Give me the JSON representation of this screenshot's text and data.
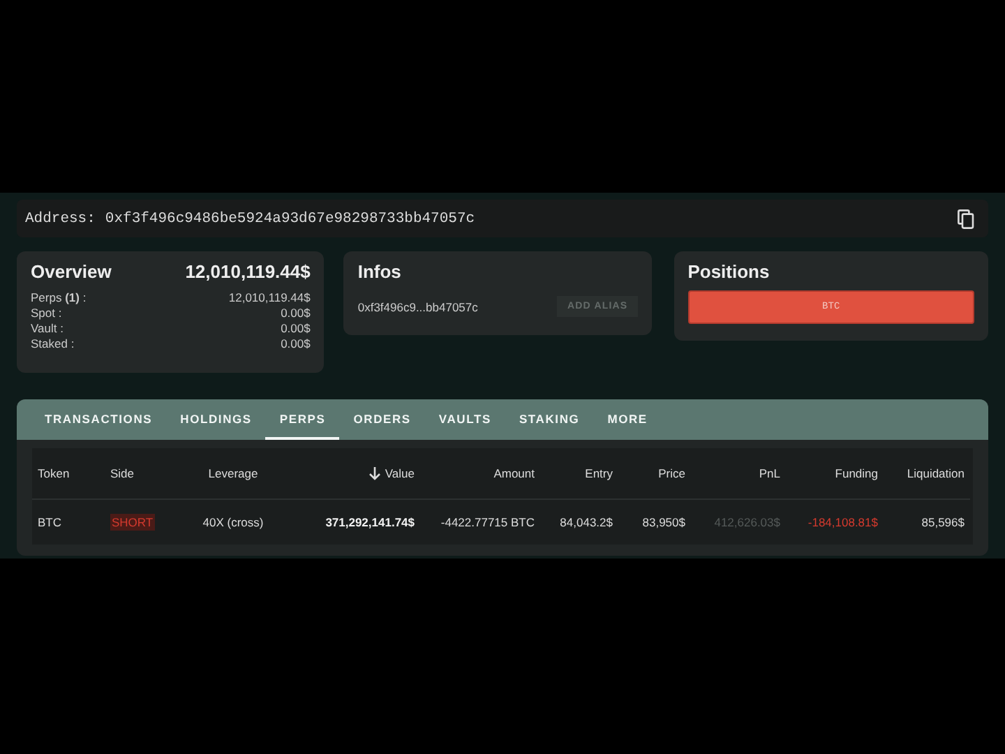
{
  "address": {
    "label": "Address:",
    "value": "0xf3f496c9486be5924a93d67e98298733bb47057c"
  },
  "overview": {
    "title": "Overview",
    "total": "12,010,119.44$",
    "rows": [
      {
        "label": "Perps **(1)** :",
        "value": "12,010,119.44$"
      },
      {
        "label": "Spot :",
        "value": "0.00$"
      },
      {
        "label": "Vault :",
        "value": "0.00$"
      },
      {
        "label": "Staked :",
        "value": "0.00$"
      }
    ]
  },
  "infos": {
    "title": "Infos",
    "short_address": "0xf3f496c9...bb47057c",
    "alias_button": "ADD ALIAS"
  },
  "positions": {
    "title": "Positions",
    "items": [
      {
        "label": "BTC",
        "color": "#e0513f"
      }
    ]
  },
  "tabs": [
    {
      "label": "TRANSACTIONS",
      "selected": false
    },
    {
      "label": "HOLDINGS",
      "selected": false
    },
    {
      "label": "PERPS",
      "selected": true
    },
    {
      "label": "ORDERS",
      "selected": false
    },
    {
      "label": "VAULTS",
      "selected": false
    },
    {
      "label": "STAKING",
      "selected": false
    },
    {
      "label": "MORE",
      "selected": false
    }
  ],
  "table": {
    "columns": [
      {
        "label": "Token",
        "sorted": false
      },
      {
        "label": "Side",
        "sorted": false
      },
      {
        "label": "Leverage",
        "sorted": false
      },
      {
        "label": "Value",
        "sorted": true
      },
      {
        "label": "Amount",
        "sorted": false
      },
      {
        "label": "Entry",
        "sorted": false
      },
      {
        "label": "Price",
        "sorted": false
      },
      {
        "label": "PnL",
        "sorted": false
      },
      {
        "label": "Funding",
        "sorted": false
      },
      {
        "label": "Liquidation",
        "sorted": false
      }
    ],
    "rows": [
      [
        {
          "text": "BTC",
          "kind": "normal"
        },
        {
          "text": "SHORT",
          "kind": "negative"
        },
        {
          "text": "40X (cross)",
          "kind": "normal"
        },
        {
          "text": "371,292,141.74$",
          "kind": "strong"
        },
        {
          "text": "-4422.77715 BTC",
          "kind": "normal"
        },
        {
          "text": "84,043.2$",
          "kind": "normal"
        },
        {
          "text": "83,950$",
          "kind": "normal"
        },
        {
          "text": "412,626.03$",
          "kind": "muted"
        },
        {
          "text": "-184,108.81$",
          "kind": "negative"
        },
        {
          "text": "85,596$",
          "kind": "normal"
        }
      ]
    ]
  }
}
